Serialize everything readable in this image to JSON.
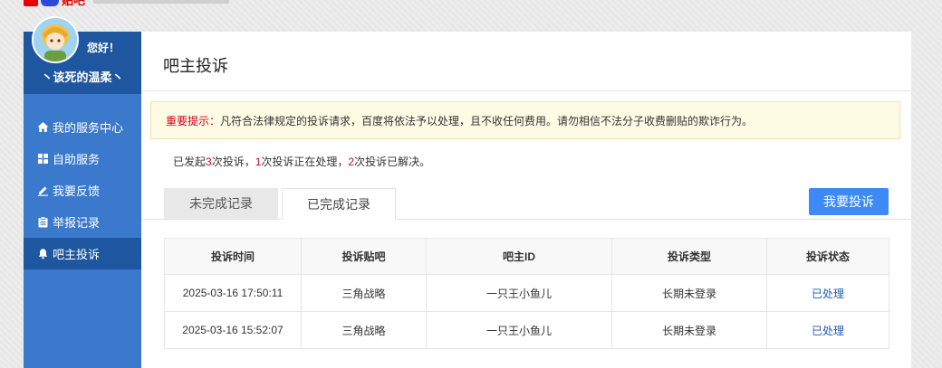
{
  "brand": {
    "text": "贴吧",
    "color": "#e10602"
  },
  "user": {
    "greeting": "您好！",
    "name": "丶该死的温柔丶"
  },
  "sidebar": {
    "items": [
      {
        "label": "我的服务中心",
        "icon": "home-icon"
      },
      {
        "label": "自助服务",
        "icon": "grid-icon"
      },
      {
        "label": "我要反馈",
        "icon": "pencil-icon"
      },
      {
        "label": "举报记录",
        "icon": "clipboard-icon"
      },
      {
        "label": "吧主投诉",
        "icon": "bell-icon",
        "active": true
      }
    ]
  },
  "page": {
    "title": "吧主投诉"
  },
  "notice": {
    "label": "重要提示：",
    "text": "凡符合法律规定的投诉请求，百度将依法予以处理，且不收任何费用。请勿相信不法分子收费删贴的欺诈行为。"
  },
  "stats": {
    "p1": "已发起",
    "n1": "3",
    "p2": "次投诉，",
    "n2": "1",
    "p3": "次投诉正在处理，",
    "n3": "2",
    "p4": "次投诉已解决。"
  },
  "tabs": [
    {
      "label": "未完成记录"
    },
    {
      "label": "已完成记录",
      "active": true
    }
  ],
  "actions": {
    "complain_label": "我要投诉"
  },
  "table": {
    "headers": [
      "投诉时间",
      "投诉贴吧",
      "吧主ID",
      "投诉类型",
      "投诉状态"
    ],
    "rows": [
      [
        "2025-03-16 17:50:11",
        "三角战略",
        "一只王小鱼儿",
        "长期未登录",
        "已处理"
      ],
      [
        "2025-03-16 15:52:07",
        "三角战略",
        "一只王小鱼儿",
        "长期未登录",
        "已处理"
      ]
    ]
  },
  "colors": {
    "sidebar": "#3b79cc",
    "sidebar_dark": "#1f56a0",
    "accent_button": "#3d8af7",
    "highlight_red": "#d0021b",
    "link": "#1e5bb8"
  }
}
